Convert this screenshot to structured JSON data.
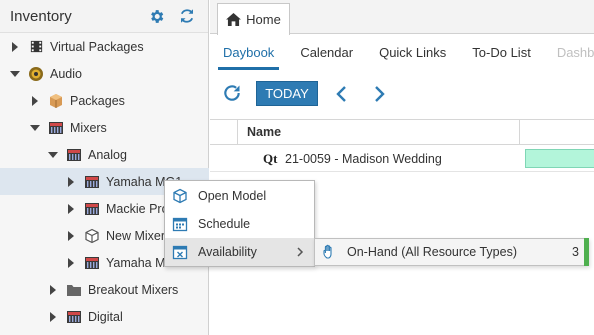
{
  "sidebar": {
    "title": "Inventory",
    "tree": [
      {
        "label": "Virtual Packages",
        "state": "collapsed",
        "icon": "film-icon"
      },
      {
        "label": "Audio",
        "state": "expanded",
        "icon": "speaker-icon"
      },
      {
        "label": "Packages",
        "state": "collapsed",
        "icon": "package-box-icon"
      },
      {
        "label": "Mixers",
        "state": "expanded",
        "icon": "mixer-icon"
      },
      {
        "label": "Analog",
        "state": "expanded",
        "icon": "mixer-icon"
      },
      {
        "label": "Yamaha MG1…",
        "state": "collapsed",
        "icon": "mixer-icon",
        "selected": true
      },
      {
        "label": "Mackie Pro",
        "state": "collapsed",
        "icon": "mixer-icon"
      },
      {
        "label": "New Mixer",
        "state": "collapsed",
        "icon": "cube-icon"
      },
      {
        "label": "Yamaha MG",
        "state": "collapsed",
        "icon": "mixer-icon"
      },
      {
        "label": "Breakout Mixers",
        "state": "collapsed",
        "icon": "folder-icon"
      },
      {
        "label": "Digital",
        "state": "collapsed",
        "icon": "mixer-icon"
      }
    ]
  },
  "tabs": {
    "home_label": "Home"
  },
  "subnav": {
    "items": [
      "Daybook",
      "Calendar",
      "Quick Links",
      "To-Do List",
      "Dashboard"
    ],
    "active_index": 0
  },
  "toolbar": {
    "today_label": "TODAY"
  },
  "grid": {
    "name_header": "Name",
    "rows": [
      {
        "type_code": "Qt",
        "name": "21-0059 - Madison Wedding"
      }
    ]
  },
  "context_menu": {
    "items": [
      {
        "label": "Open Model",
        "icon": "cube-icon"
      },
      {
        "label": "Schedule",
        "icon": "calendar-icon"
      },
      {
        "label": "Availability",
        "icon": "calendar-x-icon",
        "has_submenu": true
      }
    ],
    "submenu": {
      "label": "On-Hand (All Resource Types)",
      "count": "3",
      "icon": "hand-icon"
    }
  },
  "colors": {
    "accent": "#1f6fa8",
    "today_button": "#2e7bb3",
    "bar_fill": "#b3f5da",
    "submenu_accent": "#4fb04f"
  }
}
